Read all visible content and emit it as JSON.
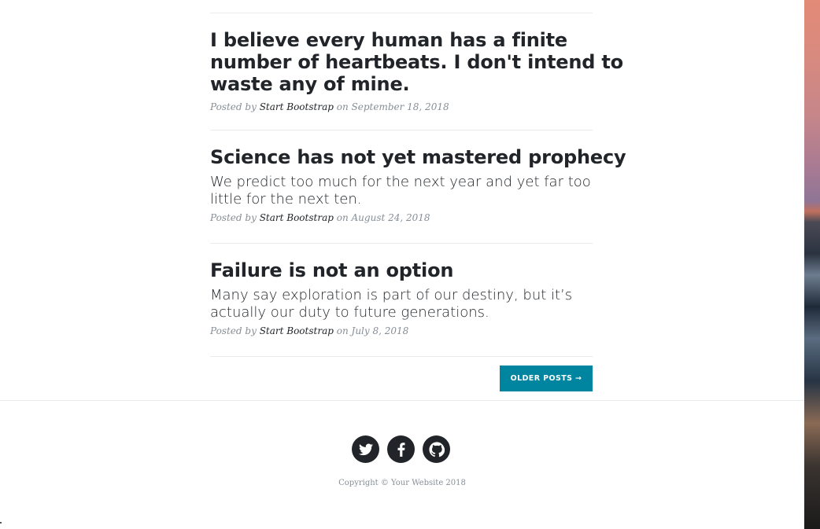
{
  "posts": [
    {
      "title_lines": [
        "I believe every human has a finite",
        "number of heartbeats. I don't intend to",
        "waste any of mine."
      ],
      "subtitle": "",
      "meta_prefix": "Posted by",
      "author": "Start Bootstrap",
      "meta_on": "on",
      "date": "September 18, 2018"
    },
    {
      "title_lines": [
        "Science has not yet mastered prophecy"
      ],
      "subtitle_lines": [
        "We predict too much for the next year and yet far too",
        "little for the next ten."
      ],
      "meta_prefix": "Posted by",
      "author": "Start Bootstrap",
      "meta_on": "on",
      "date": "August 24, 2018"
    },
    {
      "title_lines": [
        "Failure is not an option"
      ],
      "subtitle_lines": [
        "Many say exploration is part of our destiny, but it’s",
        "actually our duty to future generations."
      ],
      "meta_prefix": "Posted by",
      "author": "Start Bootstrap",
      "meta_on": "on",
      "date": "July 8, 2018"
    }
  ],
  "pager": {
    "older_label": "OLDER POSTS →"
  },
  "footer": {
    "social": [
      {
        "name": "twitter-icon"
      },
      {
        "name": "facebook-icon"
      },
      {
        "name": "github-icon"
      }
    ],
    "copyright": "Copyright © Your Website 2018"
  },
  "colors": {
    "accent": "#0085a1",
    "text": "#212529",
    "muted": "#868e96"
  }
}
